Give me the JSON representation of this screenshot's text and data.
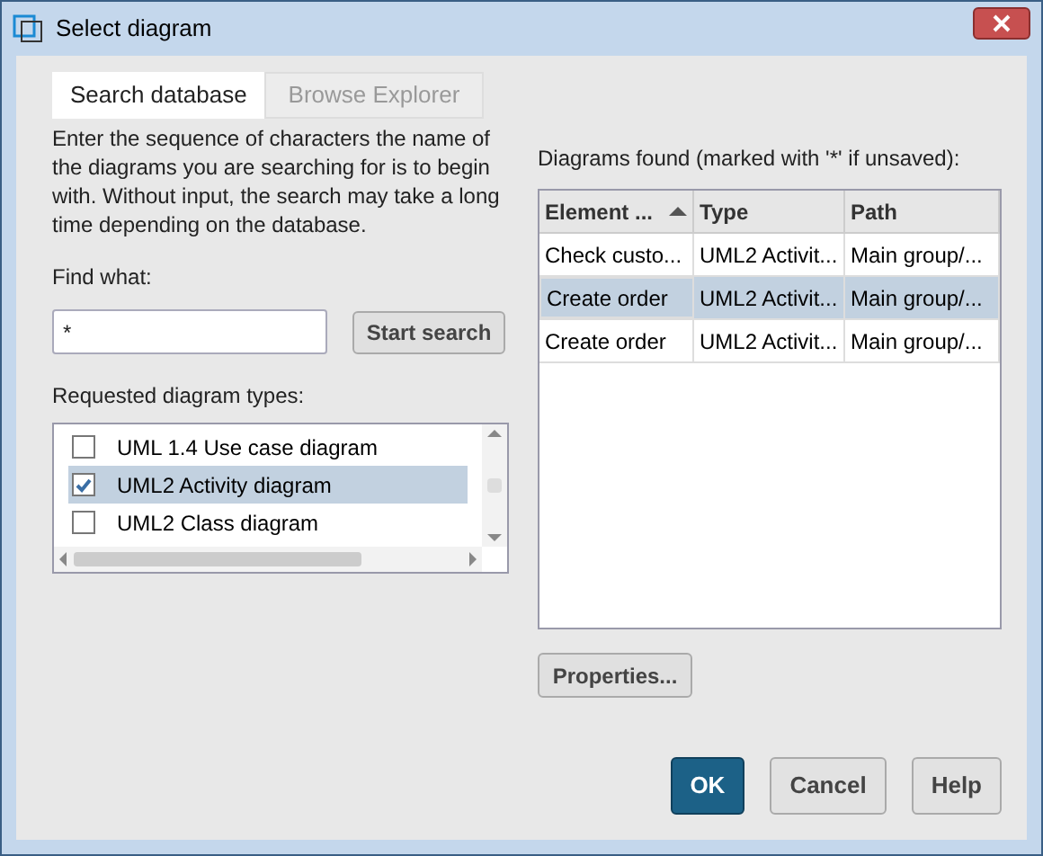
{
  "window": {
    "title": "Select diagram"
  },
  "tabs": [
    {
      "label": "Search database",
      "selected": true
    },
    {
      "label": "Browse Explorer",
      "selected": false
    }
  ],
  "description": "Enter the sequence of characters the name of the diagrams you are searching for is to begin with. Without input, the search may take a long time depending on the database.",
  "find_what": {
    "label": "Find what:",
    "value": "*"
  },
  "start_search_button": "Start search",
  "diagram_types": {
    "label": "Requested diagram types:",
    "items": [
      {
        "label": "UML 1.4 Use case diagram",
        "checked": false,
        "selected": false
      },
      {
        "label": "UML2 Activity diagram",
        "checked": true,
        "selected": true
      },
      {
        "label": "UML2 Class diagram",
        "checked": false,
        "selected": false
      }
    ]
  },
  "results": {
    "label": "Diagrams found (marked with '*' if unsaved):",
    "columns": [
      "Element ...",
      "Type",
      "Path"
    ],
    "rows": [
      {
        "cells": [
          "Check custo...",
          "UML2 Activit...",
          "Main group/..."
        ],
        "selected": false
      },
      {
        "cells": [
          "Create order",
          "UML2 Activit...",
          "Main group/..."
        ],
        "selected": true
      },
      {
        "cells": [
          "Create order",
          "UML2 Activit...",
          "Main group/..."
        ],
        "selected": false
      }
    ]
  },
  "properties_button": "Properties...",
  "buttons": [
    {
      "label": "OK",
      "kind": "default"
    },
    {
      "label": "Cancel",
      "kind": "normal"
    },
    {
      "label": "Help",
      "kind": "normal"
    }
  ]
}
